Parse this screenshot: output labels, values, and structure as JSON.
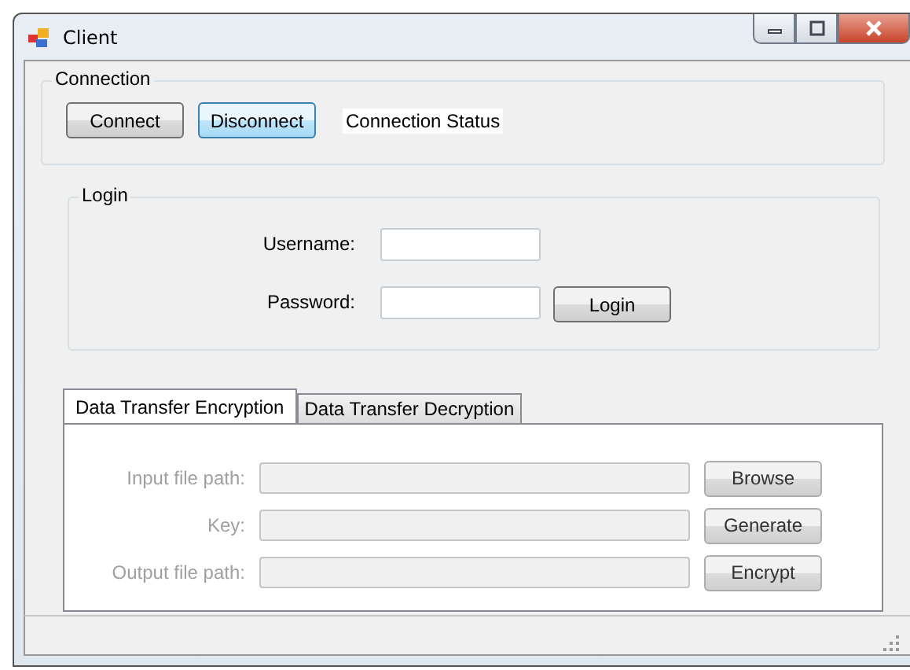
{
  "window": {
    "title": "Client"
  },
  "connection": {
    "title": "Connection",
    "buttons": [
      {
        "label": "Connect",
        "highlighted": false
      },
      {
        "label": "Disconnect",
        "highlighted": true
      }
    ],
    "status": "Connection Status"
  },
  "login": {
    "title": "Login",
    "username_label": "Username:",
    "password_label": "Password:",
    "button": "Login"
  },
  "tabs": [
    {
      "label": "Data Transfer Encryption",
      "selected": true
    },
    {
      "label": "Data Transfer Decryption",
      "selected": false
    }
  ],
  "rows": [
    {
      "label": "Input file path:",
      "disabled": true,
      "button": "Browse"
    },
    {
      "label": "Key:",
      "disabled": true,
      "button": "Generate"
    },
    {
      "label": "Output file path:",
      "disabled": true,
      "button": "Encrypt"
    }
  ]
}
